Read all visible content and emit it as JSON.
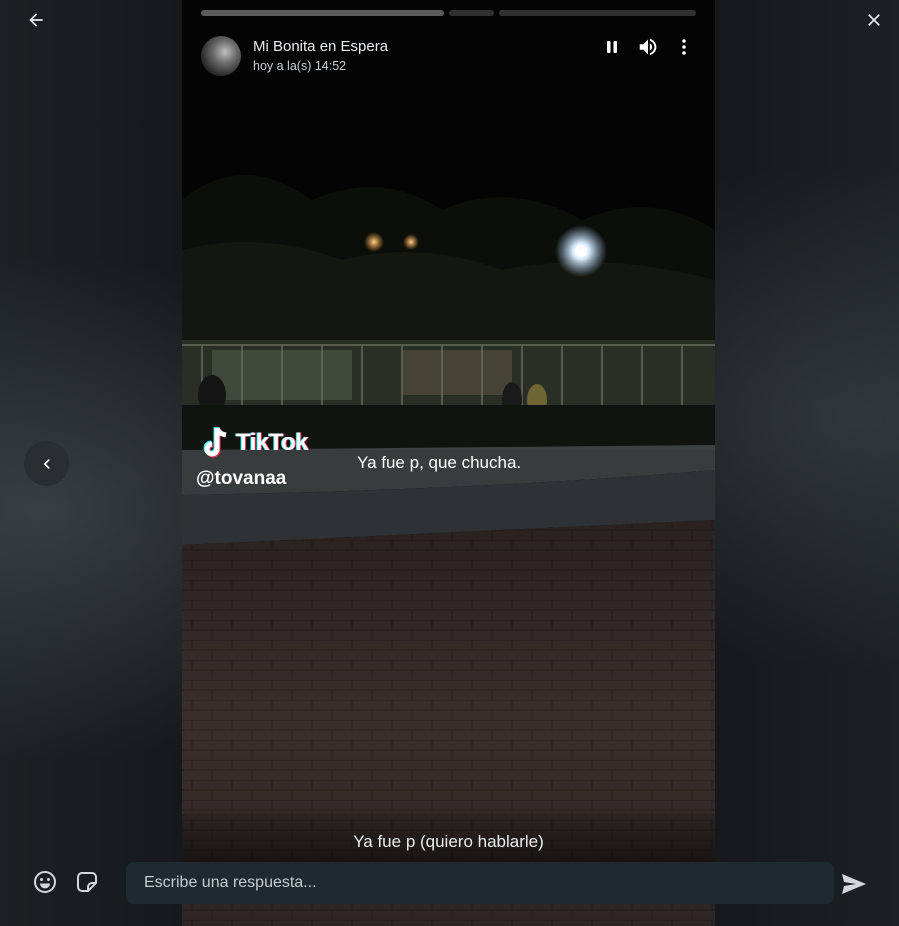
{
  "navigation": {
    "back_icon": "arrow-left-icon",
    "close_icon": "close-icon",
    "previous_icon": "chevron-left-icon"
  },
  "status": {
    "contact_name": "Mi Bonita en Espera",
    "timestamp": "hoy a la(s) 14:52",
    "progress": [
      1,
      0.0,
      0.0
    ],
    "controls": [
      "pause-icon",
      "volume-icon",
      "more-vertical-icon"
    ]
  },
  "media": {
    "tiktok_logo_text": "TikTok",
    "tiktok_username": "@tovanaa",
    "overlay_text": "Ya fue p, que chucha.",
    "caption": "Ya fue p (quiero hablarle)"
  },
  "reply": {
    "placeholder": "Escribe una respuesta...",
    "emoji_icon": "emoji-icon",
    "sticker_icon": "sticker-icon",
    "send_icon": "send-icon"
  },
  "colors": {
    "background": "#0b141a",
    "input_bg": "#1f2a30",
    "text": "#e9edef"
  }
}
